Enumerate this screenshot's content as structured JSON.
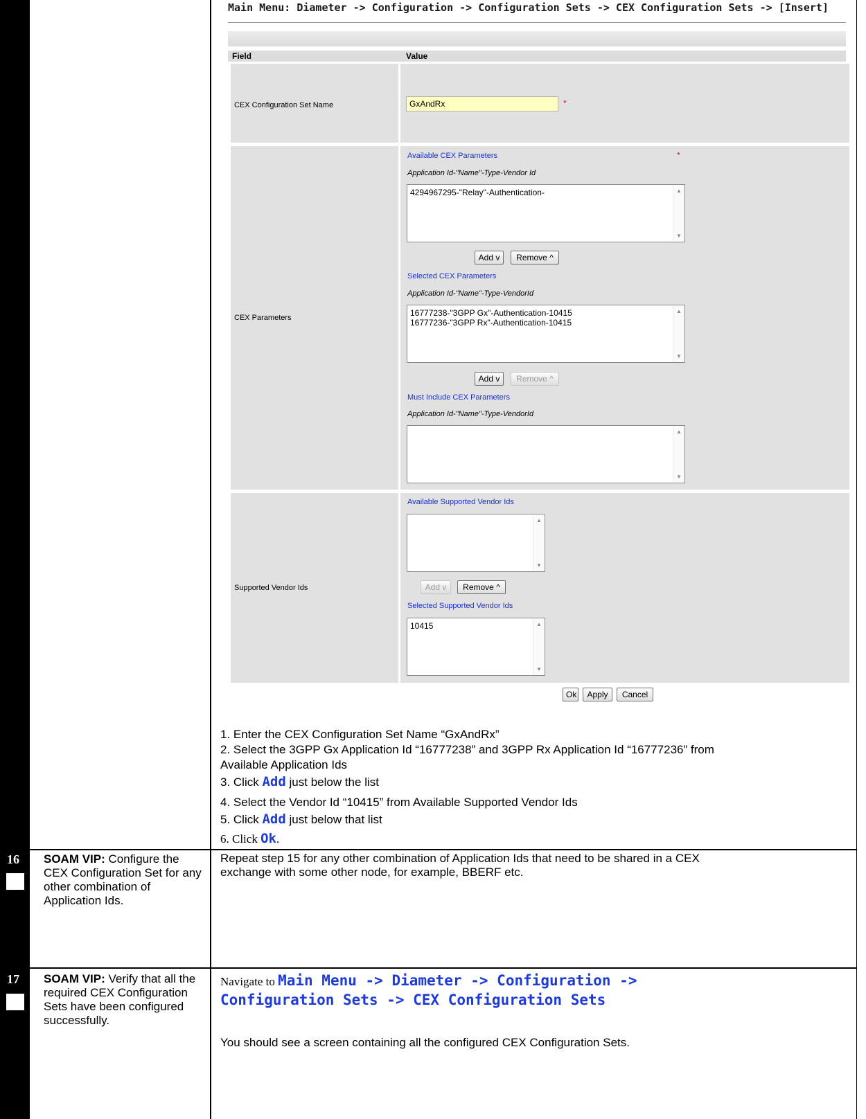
{
  "screenshot": {
    "title": "Main Menu: Diameter -> Configuration -> Configuration Sets -> CEX Configuration Sets -> [Insert]",
    "header_field": "Field",
    "header_value": "Value",
    "name_field": {
      "label": "CEX Configuration Set Name",
      "value": "GxAndRx",
      "required": "*"
    },
    "cex_parameters": {
      "label": "CEX Parameters",
      "available_title": "Available CEX Parameters",
      "available_format": "Application Id-\"Name\"-Type-Vendor Id",
      "available_items": [
        "4294967295-\"Relay\"-Authentication-"
      ],
      "selected_title": "Selected CEX Parameters",
      "selected_format": "Application Id-\"Name\"-Type-VendorId",
      "selected_items": [
        "16777238-\"3GPP Gx\"-Authentication-10415",
        "16777236-\"3GPP Rx\"-Authentication-10415"
      ],
      "must_title": "Must Include CEX Parameters",
      "must_format": "Application Id-\"Name\"-Type-VendorId",
      "required": "*"
    },
    "vendor_ids": {
      "label": "Supported Vendor Ids",
      "available_title": "Available Supported Vendor Ids",
      "selected_title": "Selected Supported Vendor Ids",
      "selected_items": [
        "10415"
      ]
    },
    "buttons": {
      "add": "Add v",
      "remove": "Remove ^",
      "ok": "Ok",
      "apply": "Apply",
      "cancel": "Cancel"
    }
  },
  "instructions": {
    "l1": "1. Enter the CEX Configuration Set Name “GxAndRx”",
    "l2": "2. Select the 3GPP Gx Application Id “16777238” and 3GPP Rx Application Id “16777236” from",
    "l2b": "Available Application Ids",
    "l3_pre": "3. Click ",
    "l3_cmd": "Add",
    "l3_post": " just below the list",
    "l4": "4. Select the Vendor Id “10415” from Available Supported Vendor Ids",
    "l5_pre": "5. Click ",
    "l5_cmd": "Add",
    "l5_post": " just below that list",
    "l6_pre": "6. Click ",
    "l6_cmd": "Ok",
    "l6_post": "."
  },
  "steps": [
    {
      "number": "16",
      "desc_bold": "SOAM VIP:",
      "desc_text": " Configure the CEX Configuration Set for any other combination of Application Ids.",
      "content_l1": "Repeat step 15 for any other combination of Application Ids that need to be shared in a CEX",
      "content_l2": "exchange with some other node, for example, BBERF etc."
    },
    {
      "number": "17",
      "desc_bold": "SOAM VIP:",
      "desc_text": " Verify that all the required CEX Configuration Sets have been configured successfully.",
      "nav_pre": "Navigate to ",
      "nav_l1": "Main Menu -> Diameter -> Configuration ->",
      "nav_l2": "Configuration Sets -> CEX Configuration Sets",
      "result": "You should see a screen containing all the configured CEX Configuration Sets."
    }
  ]
}
